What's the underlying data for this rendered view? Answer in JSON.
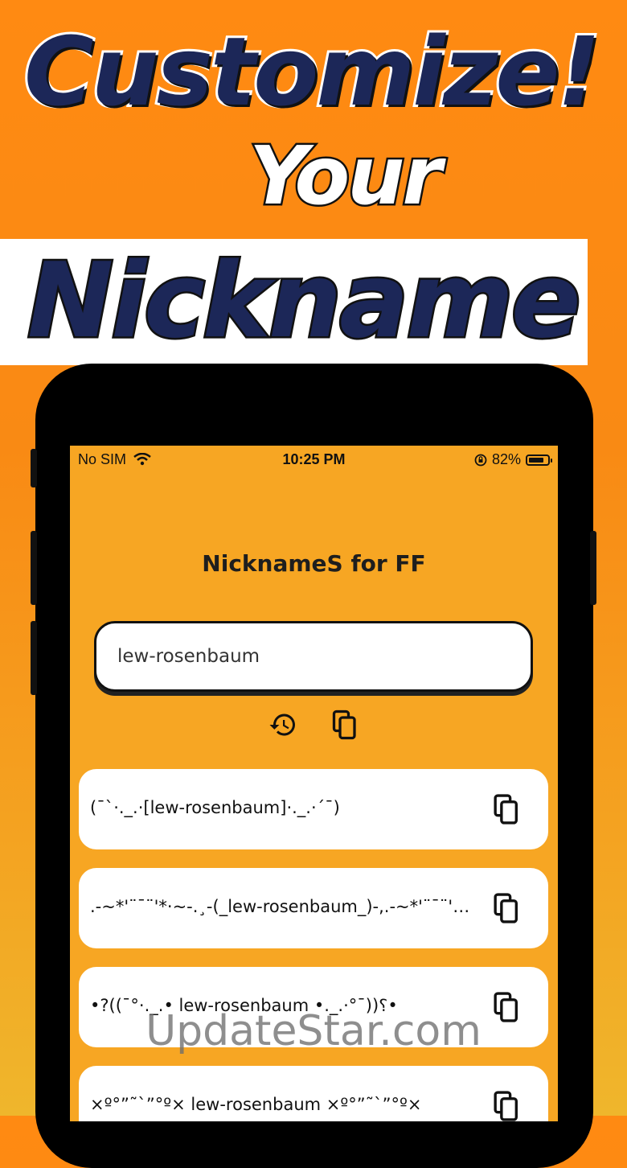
{
  "promo": {
    "line1": "Customize!",
    "line2": "Your",
    "line3": "Nickname"
  },
  "status_bar": {
    "carrier": "No SIM",
    "time": "10:25 PM",
    "battery": "82%",
    "battery_level": 0.82
  },
  "app": {
    "title": "NicknameS for FF",
    "input_value": "lew-rosenbaum",
    "history_icon": "history-icon",
    "copy_all_icon": "copy-icon"
  },
  "results": [
    {
      "text": "(¯`·._.·[lew-rosenbaum]·._.·´¯)"
    },
    {
      "text": ".-~*'¨¯¨'*·~-.¸-(_lew-rosenbaum_)-,.-~*'¨¯¨'*·~-."
    },
    {
      "text": "•?((¯°·._.• lew-rosenbaum •._.·°¯))؟•"
    },
    {
      "text": "×º°”˜`”°º× lew-rosenbaum ×º°”˜`”°º×"
    }
  ],
  "watermark": "UpdateStar.com",
  "colors": {
    "background_top": "#ff8a12",
    "screen": "#f7a623",
    "headline_navy": "#1c2758"
  }
}
